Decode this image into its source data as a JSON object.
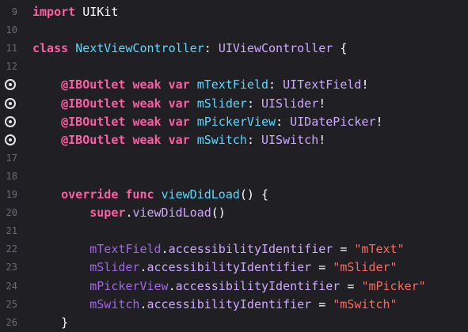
{
  "lines": [
    {
      "num": "9",
      "tokens": [
        [
          "kw",
          "import"
        ],
        [
          "plain",
          " UIKit"
        ]
      ]
    },
    {
      "num": "10",
      "tokens": []
    },
    {
      "num": "11",
      "tokens": [
        [
          "kw",
          "class"
        ],
        [
          "plain",
          " "
        ],
        [
          "decl",
          "NextViewController"
        ],
        [
          "plain",
          ": "
        ],
        [
          "type",
          "UIViewController"
        ],
        [
          "plain",
          " {"
        ]
      ]
    },
    {
      "num": "12",
      "tokens": []
    },
    {
      "num": "13",
      "breakpoint": true,
      "tokens": [
        [
          "plain",
          "    "
        ],
        [
          "kw",
          "@IBOutlet"
        ],
        [
          "plain",
          " "
        ],
        [
          "kw",
          "weak"
        ],
        [
          "plain",
          " "
        ],
        [
          "kw",
          "var"
        ],
        [
          "plain",
          " "
        ],
        [
          "decl",
          "mTextField"
        ],
        [
          "plain",
          ": "
        ],
        [
          "type",
          "UITextField"
        ],
        [
          "plain",
          "!"
        ]
      ]
    },
    {
      "num": "14",
      "breakpoint": true,
      "tokens": [
        [
          "plain",
          "    "
        ],
        [
          "kw",
          "@IBOutlet"
        ],
        [
          "plain",
          " "
        ],
        [
          "kw",
          "weak"
        ],
        [
          "plain",
          " "
        ],
        [
          "kw",
          "var"
        ],
        [
          "plain",
          " "
        ],
        [
          "decl",
          "mSlider"
        ],
        [
          "plain",
          ": "
        ],
        [
          "type",
          "UISlider"
        ],
        [
          "plain",
          "!"
        ]
      ]
    },
    {
      "num": "15",
      "breakpoint": true,
      "tokens": [
        [
          "plain",
          "    "
        ],
        [
          "kw",
          "@IBOutlet"
        ],
        [
          "plain",
          " "
        ],
        [
          "kw",
          "weak"
        ],
        [
          "plain",
          " "
        ],
        [
          "kw",
          "var"
        ],
        [
          "plain",
          " "
        ],
        [
          "decl",
          "mPickerView"
        ],
        [
          "plain",
          ": "
        ],
        [
          "type",
          "UIDatePicker"
        ],
        [
          "plain",
          "!"
        ]
      ]
    },
    {
      "num": "16",
      "breakpoint": true,
      "tokens": [
        [
          "plain",
          "    "
        ],
        [
          "kw",
          "@IBOutlet"
        ],
        [
          "plain",
          " "
        ],
        [
          "kw",
          "weak"
        ],
        [
          "plain",
          " "
        ],
        [
          "kw",
          "var"
        ],
        [
          "plain",
          " "
        ],
        [
          "decl",
          "mSwitch"
        ],
        [
          "plain",
          ": "
        ],
        [
          "type",
          "UISwitch"
        ],
        [
          "plain",
          "!"
        ]
      ]
    },
    {
      "num": "17",
      "tokens": []
    },
    {
      "num": "18",
      "tokens": []
    },
    {
      "num": "19",
      "tokens": [
        [
          "plain",
          "    "
        ],
        [
          "kw",
          "override"
        ],
        [
          "plain",
          " "
        ],
        [
          "kw",
          "func"
        ],
        [
          "plain",
          " "
        ],
        [
          "decl",
          "viewDidLoad"
        ],
        [
          "plain",
          "() {"
        ]
      ]
    },
    {
      "num": "20",
      "tokens": [
        [
          "plain",
          "        "
        ],
        [
          "kw",
          "super"
        ],
        [
          "plain",
          "."
        ],
        [
          "type",
          "viewDidLoad"
        ],
        [
          "plain",
          "()"
        ]
      ]
    },
    {
      "num": "21",
      "tokens": []
    },
    {
      "num": "22",
      "tokens": [
        [
          "plain",
          "        "
        ],
        [
          "ivar",
          "mTextField"
        ],
        [
          "plain",
          "."
        ],
        [
          "type",
          "accessibilityIdentifier"
        ],
        [
          "plain",
          " = "
        ],
        [
          "str",
          "\"mText\""
        ]
      ]
    },
    {
      "num": "23",
      "tokens": [
        [
          "plain",
          "        "
        ],
        [
          "ivar",
          "mSlider"
        ],
        [
          "plain",
          "."
        ],
        [
          "type",
          "accessibilityIdentifier"
        ],
        [
          "plain",
          " = "
        ],
        [
          "str",
          "\"mSlider\""
        ]
      ]
    },
    {
      "num": "24",
      "tokens": [
        [
          "plain",
          "        "
        ],
        [
          "ivar",
          "mPickerView"
        ],
        [
          "plain",
          "."
        ],
        [
          "type",
          "accessibilityIdentifier"
        ],
        [
          "plain",
          " = "
        ],
        [
          "str",
          "\"mPicker\""
        ]
      ]
    },
    {
      "num": "25",
      "tokens": [
        [
          "plain",
          "        "
        ],
        [
          "ivar",
          "mSwitch"
        ],
        [
          "plain",
          "."
        ],
        [
          "type",
          "accessibilityIdentifier"
        ],
        [
          "plain",
          " = "
        ],
        [
          "str",
          "\"mSwitch\""
        ]
      ]
    },
    {
      "num": "26",
      "tokens": [
        [
          "plain",
          "    }"
        ]
      ]
    }
  ]
}
